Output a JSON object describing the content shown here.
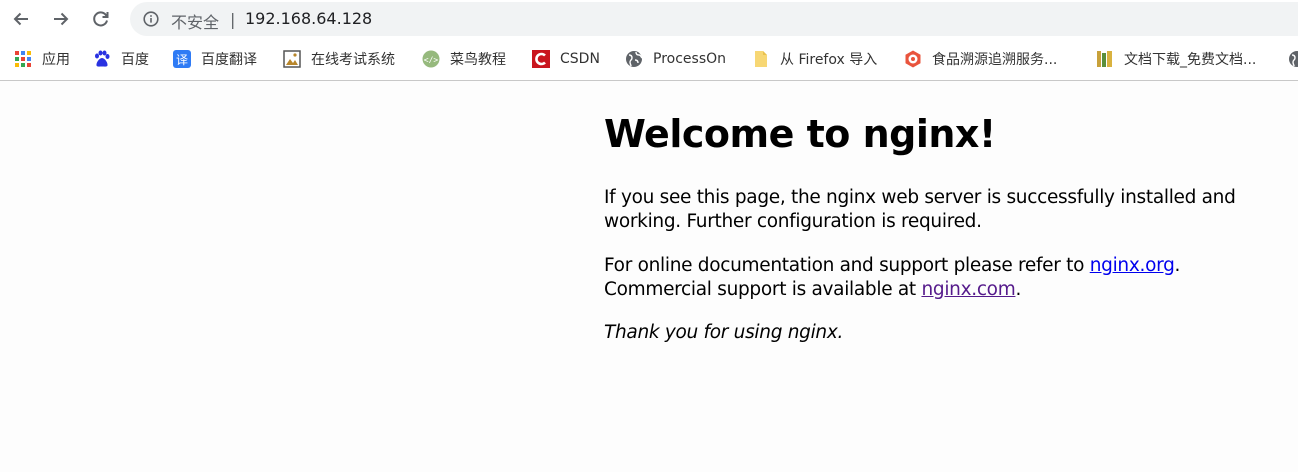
{
  "browser": {
    "security_label": "不安全",
    "separator": "|",
    "url": "192.168.64.128"
  },
  "bookmarks": [
    {
      "label": "应用",
      "icon": "apps-grid-icon"
    },
    {
      "label": "百度",
      "icon": "baidu-paw-icon"
    },
    {
      "label": "百度翻译",
      "icon": "translate-icon"
    },
    {
      "label": "在线考试系统",
      "icon": "exam-image-icon"
    },
    {
      "label": "菜鸟教程",
      "icon": "runoob-icon"
    },
    {
      "label": "CSDN",
      "icon": "csdn-icon"
    },
    {
      "label": "ProcessOn",
      "icon": "globe-icon"
    },
    {
      "label": "从 Firefox 导入",
      "icon": "folder-icon"
    },
    {
      "label": "食品溯源追溯服务...",
      "icon": "food-trace-icon"
    },
    {
      "label": "文档下载_免费文档...",
      "icon": "doc-download-icon"
    }
  ],
  "page": {
    "heading": "Welcome to nginx!",
    "para1": "If you see this page, the nginx web server is successfully installed and working. Further configuration is required.",
    "para2_before": "For online documentation and support please refer to ",
    "link_org": "nginx.org",
    "para2_mid": ".",
    "para2_line2": "Commercial support is available at ",
    "link_com": "nginx.com",
    "para2_end": ".",
    "thanks": "Thank you for using nginx."
  },
  "colors": {
    "link": "#0000ee",
    "visited_link": "#551a8b",
    "csdn_red": "#c9151e",
    "baidu_blue": "#2932e1"
  }
}
